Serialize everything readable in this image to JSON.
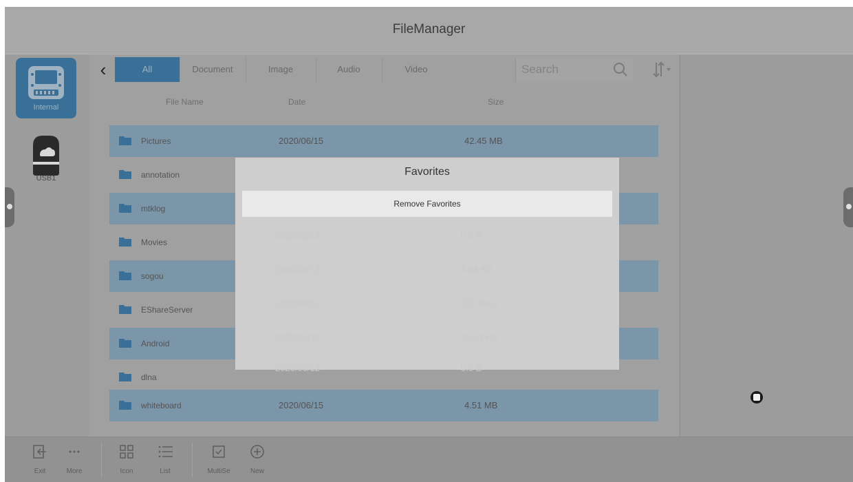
{
  "app": {
    "title": "FileManager"
  },
  "sidebar": {
    "devices": [
      {
        "label": "Internal",
        "active": true
      },
      {
        "label": "USB1",
        "active": false
      }
    ]
  },
  "tabs": [
    {
      "label": "All",
      "active": true
    },
    {
      "label": "Document"
    },
    {
      "label": "Image"
    },
    {
      "label": "Audio"
    },
    {
      "label": "Video"
    }
  ],
  "search": {
    "placeholder": "Search"
  },
  "columns": {
    "name": "File Name",
    "date": "Date",
    "size": "Size"
  },
  "files": [
    {
      "name": "Pictures",
      "date": "2020/06/15",
      "size": "42.45 MB"
    },
    {
      "name": "annotation",
      "date": "",
      "size": ""
    },
    {
      "name": "mtklog",
      "date": "",
      "size": ""
    },
    {
      "name": "Movies",
      "date": "2020/06/12",
      "size": "0.0 B"
    },
    {
      "name": "sogou",
      "date": "2020/06/12",
      "size": "4.64 KB"
    },
    {
      "name": "EShareServer",
      "date": "2020/06/12",
      "size": "332.8 KB"
    },
    {
      "name": "Android",
      "date": "2020/06/12",
      "size": "22.53 KB"
    },
    {
      "name": "dlna",
      "date": "2020/06/12",
      "size": "0.0 B"
    },
    {
      "name": "whiteboard",
      "date": "2020/06/15",
      "size": "4.51 MB"
    }
  ],
  "toolbar": {
    "exit": "Exit",
    "more": "More",
    "icon": "Icon",
    "list": "List",
    "multisel": "MultiSe",
    "new": "New"
  },
  "dialog": {
    "title": "Favorites",
    "action": "Remove Favorites"
  },
  "colors": {
    "accent": "#3a6f97",
    "row_alt": "#7b95a9",
    "overlay_bg": "#9a9a9a"
  }
}
